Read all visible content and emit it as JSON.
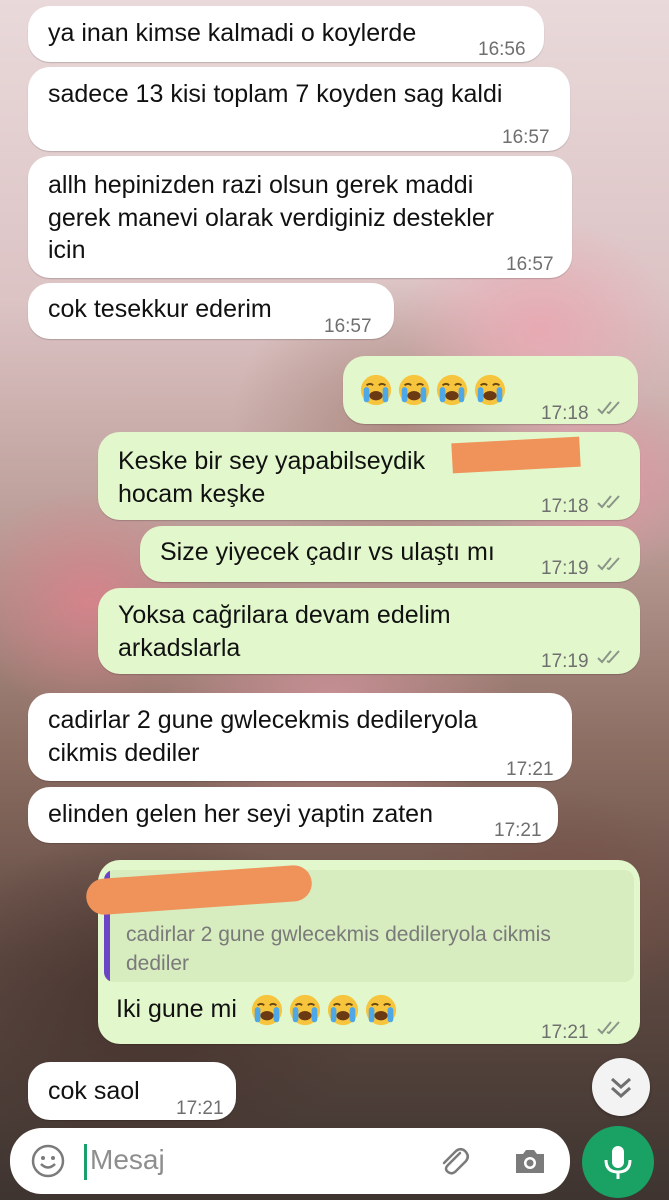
{
  "messages": [
    {
      "text_lines": [
        "ya inan kimse kalmadi o koylerde"
      ],
      "time": "16:56"
    },
    {
      "text_lines": [
        "sadece 13 kisi toplam 7 koyden sag kaldi"
      ],
      "time": "16:57"
    },
    {
      "text_lines": [
        "allh hepinizden razi olsun gerek maddi",
        "gerek manevi olarak verdiginiz destekler",
        "icin"
      ],
      "time": "16:57"
    },
    {
      "text_lines": [
        "cok tesekkur ederim"
      ],
      "time": "16:57"
    },
    {
      "emoji": [
        "crying-face",
        "crying-face",
        "crying-face",
        "crying-face"
      ],
      "time": "17:18"
    },
    {
      "text_lines": [
        "Keske bir sey yapabilseydik",
        "hocam keşke"
      ],
      "time": "17:18"
    },
    {
      "text_lines": [
        "Size yiyecek çadır vs ulaştı mı"
      ],
      "time": "17:19"
    },
    {
      "text_lines": [
        "Yoksa cağrilara devam edelim",
        "arkadslarla"
      ],
      "time": "17:19"
    },
    {
      "text_lines": [
        "cadirlar 2 gune gwlecekmis dedileryola",
        "cikmis dediler"
      ],
      "time": "17:21"
    },
    {
      "text_lines": [
        "elinden gelen her seyi yaptin zaten"
      ],
      "time": "17:21"
    },
    {
      "quote_lines": [
        "cadirlar 2 gune gwlecekmis dedileryola cikmis",
        "dediler"
      ],
      "text": "Iki gune mi",
      "emoji": [
        "crying-face",
        "crying-face",
        "crying-face",
        "crying-face"
      ],
      "time": "17:21"
    },
    {
      "text_lines": [
        "cok saol"
      ],
      "time": "17:21"
    }
  ],
  "input": {
    "placeholder": "Mesaj"
  },
  "icons": {
    "emoji_button": "smiley-icon",
    "attach": "paperclip-icon",
    "camera": "camera-icon",
    "mic": "microphone-icon",
    "scroll_down": "double-chevron-down-icon",
    "read_receipt": "double-check-icon"
  },
  "colors": {
    "outgoing_bubble": "#e2f8cc",
    "incoming_bubble": "#ffffff",
    "quote_bar": "#6b45c6",
    "mic_button": "#1aa164",
    "read_ticks": "#8a9488",
    "redaction": "#f0935a"
  }
}
